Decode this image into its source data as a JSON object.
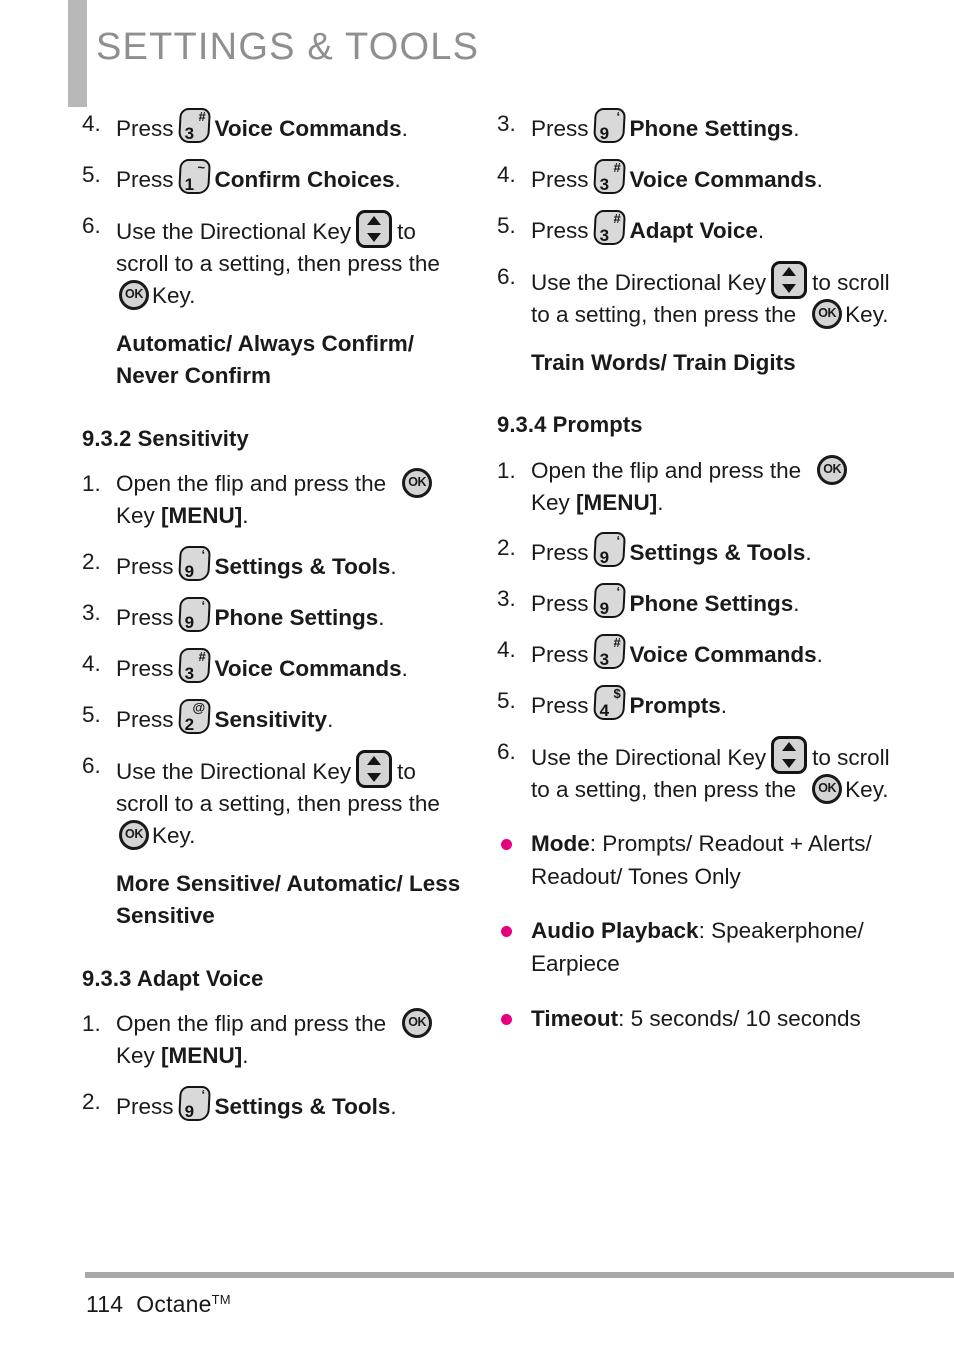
{
  "header": {
    "title": "SETTINGS & TOOLS",
    "accent_bar_color": "#b8b8b8",
    "title_color": "#8f8f8f"
  },
  "colors": {
    "bullet": "#e6007e",
    "rule": "#a8a8a8",
    "key_face": "#d9d9d9",
    "key_border": "#141414"
  },
  "left_column": {
    "steps_continued": [
      {
        "num": "4.",
        "pre": "Press",
        "key": {
          "digit": "3",
          "symbol": "#",
          "name": "phone-key-3"
        },
        "label": "Voice Commands",
        "period": "."
      },
      {
        "num": "5.",
        "pre": "Press",
        "key": {
          "digit": "1",
          "symbol": "~",
          "name": "phone-key-1"
        },
        "label": "Confirm Choices",
        "period": "."
      },
      {
        "num": "6.",
        "pre": "Use the Directional Key",
        "mid": "to scroll to a setting, then press the",
        "post": "Key."
      }
    ],
    "options_1": "Automatic/ Always Confirm/ Never Confirm",
    "section_932": {
      "heading": "9.3.2 Sensitivity",
      "steps": [
        {
          "num": "1.",
          "text_a": "Open the flip and press the",
          "text_b": "Key",
          "bracket": "[MENU]",
          "period": "."
        },
        {
          "num": "2.",
          "pre": "Press",
          "key": {
            "digit": "9",
            "symbol": "‘",
            "name": "phone-key-9"
          },
          "label": "Settings & Tools",
          "period": "."
        },
        {
          "num": "3.",
          "pre": "Press",
          "key": {
            "digit": "9",
            "symbol": "‘",
            "name": "phone-key-9"
          },
          "label": "Phone Settings",
          "period": "."
        },
        {
          "num": "4.",
          "pre": "Press",
          "key": {
            "digit": "3",
            "symbol": "#",
            "name": "phone-key-3"
          },
          "label": "Voice Commands",
          "period": "."
        },
        {
          "num": "5.",
          "pre": "Press",
          "key": {
            "digit": "2",
            "symbol": "@",
            "name": "phone-key-2"
          },
          "label": "Sensitivity",
          "period": "."
        },
        {
          "num": "6.",
          "pre": "Use the Directional Key",
          "mid": "to scroll to a setting, then press the",
          "post": "Key."
        }
      ],
      "options": "More Sensitive/ Automatic/ Less Sensitive"
    },
    "section_933": {
      "heading": "9.3.3 Adapt Voice",
      "steps": [
        {
          "num": "1.",
          "text_a": "Open the flip and press the",
          "text_b": "Key",
          "bracket": "[MENU]",
          "period": "."
        },
        {
          "num": "2.",
          "pre": "Press",
          "key": {
            "digit": "9",
            "symbol": "‘",
            "name": "phone-key-9"
          },
          "label": "Settings & Tools",
          "period": "."
        }
      ]
    }
  },
  "right_column": {
    "section_933_cont": {
      "steps": [
        {
          "num": "3.",
          "pre": "Press",
          "key": {
            "digit": "9",
            "symbol": "‘",
            "name": "phone-key-9"
          },
          "label": "Phone Settings",
          "period": "."
        },
        {
          "num": "4.",
          "pre": "Press",
          "key": {
            "digit": "3",
            "symbol": "#",
            "name": "phone-key-3"
          },
          "label": "Voice Commands",
          "period": "."
        },
        {
          "num": "5.",
          "pre": "Press",
          "key": {
            "digit": "3",
            "symbol": "#",
            "name": "phone-key-3"
          },
          "label": "Adapt Voice",
          "period": "."
        },
        {
          "num": "6.",
          "pre": "Use the Directional Key",
          "mid": "to scroll to a setting, then press the",
          "post": "Key."
        }
      ],
      "options": "Train Words/ Train Digits"
    },
    "section_934": {
      "heading": "9.3.4 Prompts",
      "steps": [
        {
          "num": "1.",
          "text_a": "Open the flip and press the",
          "text_b": "Key",
          "bracket": "[MENU]",
          "period": "."
        },
        {
          "num": "2.",
          "pre": "Press",
          "key": {
            "digit": "9",
            "symbol": "‘",
            "name": "phone-key-9"
          },
          "label": "Settings & Tools",
          "period": "."
        },
        {
          "num": "3.",
          "pre": "Press",
          "key": {
            "digit": "9",
            "symbol": "‘",
            "name": "phone-key-9"
          },
          "label": "Phone Settings",
          "period": "."
        },
        {
          "num": "4.",
          "pre": "Press",
          "key": {
            "digit": "3",
            "symbol": "#",
            "name": "phone-key-3"
          },
          "label": "Voice Commands",
          "period": "."
        },
        {
          "num": "5.",
          "pre": "Press",
          "key": {
            "digit": "4",
            "symbol": "$",
            "name": "phone-key-4"
          },
          "label": "Prompts",
          "period": "."
        },
        {
          "num": "6.",
          "pre": "Use the Directional Key",
          "mid": "to scroll to a setting, then press the",
          "post": "Key."
        }
      ],
      "bullets": [
        {
          "term": "Mode",
          "sep": ": ",
          "values": "Prompts/ Readout + Alerts/ Readout/ Tones Only"
        },
        {
          "term": "Audio Playback",
          "sep": ": ",
          "values": "Speakerphone/ Earpiece"
        },
        {
          "term": "Timeout",
          "sep": ": ",
          "values": "5 seconds/ 10 seconds"
        }
      ]
    }
  },
  "footer": {
    "page_number": "114",
    "product": "Octane",
    "trademark": "TM"
  },
  "icons": {
    "ok_key_label": "OK",
    "directional_key": "directional-key-icon"
  }
}
